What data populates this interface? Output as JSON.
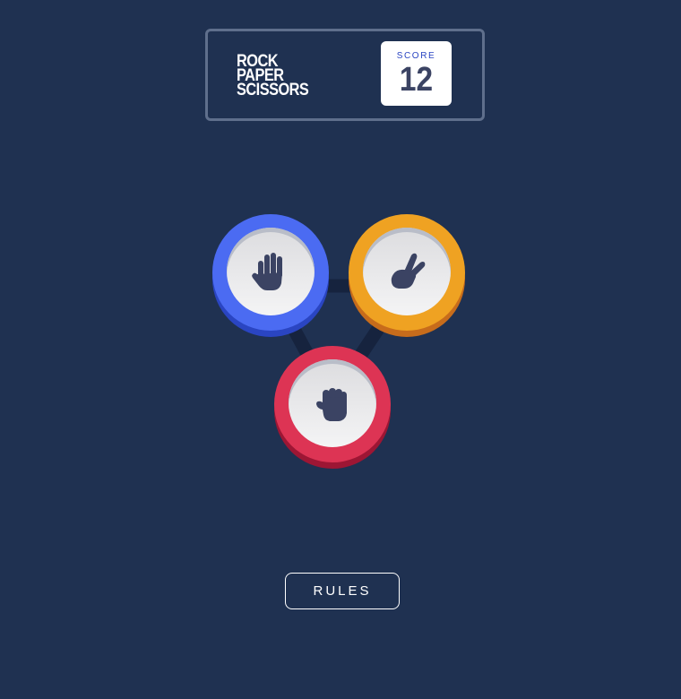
{
  "header": {
    "title_lines": [
      "ROCK",
      "PAPER",
      "SCISSORS"
    ],
    "score_label": "SCORE",
    "score_value": "12"
  },
  "choices": [
    {
      "id": "paper",
      "icon": "hand-paper-icon",
      "color": "#4b6bf2"
    },
    {
      "id": "scissors",
      "icon": "hand-scissors-icon",
      "color": "#efa222"
    },
    {
      "id": "rock",
      "icon": "hand-rock-icon",
      "color": "#dd3454"
    }
  ],
  "colors": {
    "background": "#1f3151",
    "header_border": "#5f6f8c",
    "triangle": "#16233e",
    "icon": "#3b4363"
  },
  "rules_button": {
    "label": "RULES"
  }
}
